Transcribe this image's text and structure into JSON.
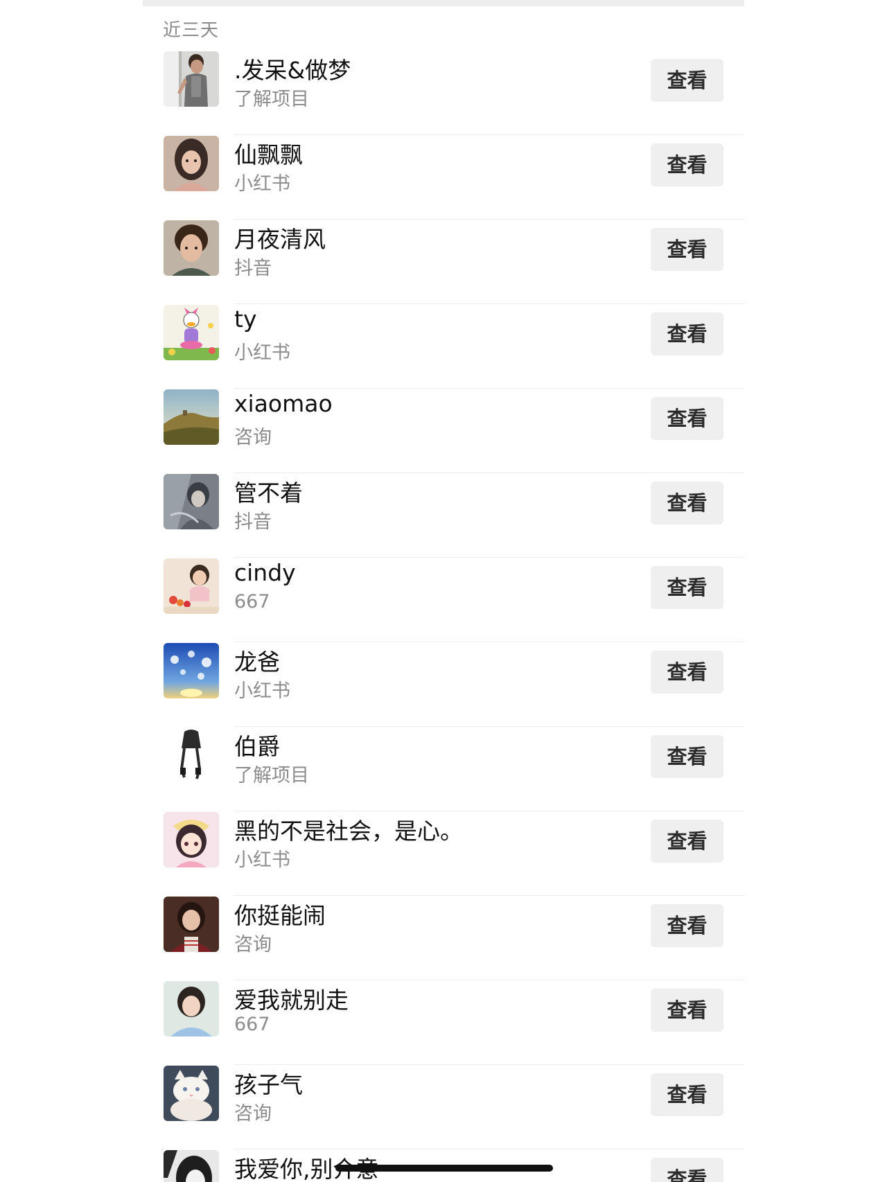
{
  "section_title": "近三天",
  "view_label": "查看",
  "contacts": [
    {
      "name": ".发呆&做梦",
      "source": "了解项目",
      "avatar": "man-leaning-photo"
    },
    {
      "name": "仙飘飘",
      "source": "小红书",
      "avatar": "girl-portrait-photo"
    },
    {
      "name": "月夜清风",
      "source": "抖音",
      "avatar": "young-man-portrait-photo"
    },
    {
      "name": "ty",
      "source": "小红书",
      "avatar": "cartoon-duck-drawing"
    },
    {
      "name": "xiaomao",
      "source": "咨询",
      "avatar": "landscape-hill-photo"
    },
    {
      "name": "管不着",
      "source": "抖音",
      "avatar": "sketch-girl-drawing"
    },
    {
      "name": "cindy",
      "source": "667",
      "avatar": "child-with-flowers-photo"
    },
    {
      "name": "龙爸",
      "source": "小红书",
      "avatar": "sky-clouds-photo"
    },
    {
      "name": "伯爵",
      "source": "了解项目",
      "avatar": "sketch-legs-drawing"
    },
    {
      "name": "黑的不是社会，是心。",
      "source": "小红书",
      "avatar": "anime-girl-drawing"
    },
    {
      "name": "你挺能闹",
      "source": "咨询",
      "avatar": "woman-dark-photo"
    },
    {
      "name": "爱我就别走",
      "source": "667",
      "avatar": "woman-outdoor-photo"
    },
    {
      "name": "孩子气",
      "source": "咨询",
      "avatar": "white-cat-photo"
    },
    {
      "name": "我爱你,别介意",
      "source": "",
      "avatar": "bw-girl-drawing"
    }
  ],
  "colors": {
    "page_background": "#ffffff",
    "button_background": "#efefef",
    "secondary_text": "#8c8c8c"
  }
}
